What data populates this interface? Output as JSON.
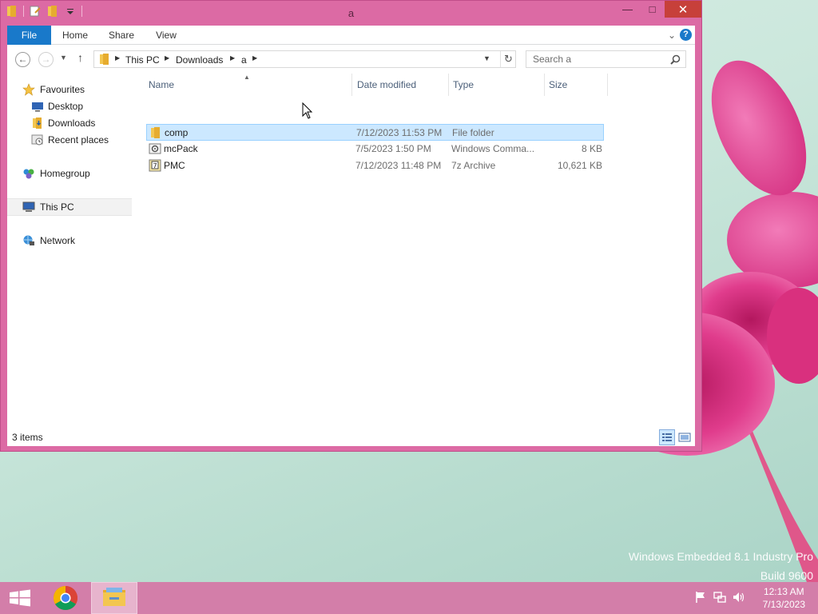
{
  "window": {
    "title": "a",
    "controls": {
      "minimize": "—",
      "maximize": "□",
      "close": "✕"
    }
  },
  "ribbon": {
    "tabs": [
      "File",
      "Home",
      "Share",
      "View"
    ],
    "expand_glyph": "⌄",
    "help_glyph": "?"
  },
  "address_bar": {
    "breadcrumbs": [
      "This PC",
      "Downloads",
      "a"
    ],
    "search_placeholder": "Search a"
  },
  "nav_pane": {
    "favourites": "Favourites",
    "favourite_items": [
      "Desktop",
      "Downloads",
      "Recent places"
    ],
    "homegroup": "Homegroup",
    "this_pc": "This PC",
    "network": "Network"
  },
  "file_list": {
    "columns": [
      "Name",
      "Date modified",
      "Type",
      "Size"
    ],
    "rows": [
      {
        "name": "comp",
        "date": "7/12/2023 11:53 PM",
        "type": "File folder",
        "size": "",
        "icon": "folder-icon",
        "selected": true
      },
      {
        "name": "mcPack",
        "date": "7/5/2023 1:50 PM",
        "type": "Windows Comma...",
        "size": "8 KB",
        "icon": "batch-file-icon",
        "selected": false
      },
      {
        "name": "PMC",
        "date": "7/12/2023 11:48 PM",
        "type": "7z Archive",
        "size": "10,621 KB",
        "icon": "archive-icon",
        "selected": false
      }
    ]
  },
  "status_bar": {
    "item_count": "3 items"
  },
  "desktop": {
    "watermark_line1": "Windows Embedded 8.1 Industry Pro",
    "watermark_line2": "Build 9600"
  },
  "taskbar": {
    "time": "12:13 AM",
    "date": "7/13/2023"
  },
  "colors": {
    "window_frame": "#dc6aa4",
    "taskbar": "#d37ea9",
    "accent": "#1979ca",
    "selection": "#cce8ff"
  }
}
